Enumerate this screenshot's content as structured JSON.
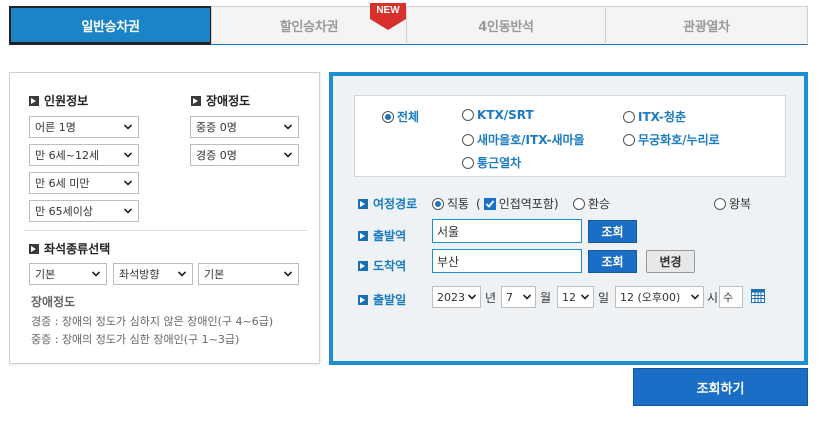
{
  "tabs": [
    {
      "label": "일반승차권",
      "active": true
    },
    {
      "label": "할인승차권",
      "badge": "NEW"
    },
    {
      "label": "4인동반석"
    },
    {
      "label": "관광열차"
    }
  ],
  "passengers": {
    "title": "인원정보",
    "selects": [
      "어른 1명",
      "만 6세~12세",
      "만 6세 미만",
      "만 65세이상"
    ]
  },
  "disability": {
    "title": "장애정도",
    "selects": [
      "중증 0명",
      "경증 0명"
    ]
  },
  "seat": {
    "title": "좌석종류선택",
    "selects": [
      "기본",
      "좌석방향",
      "기본"
    ]
  },
  "disability_info": {
    "title": "장애정도",
    "lines": [
      "경증 : 장애의 정도가 심하지 않은 장애인(구 4~6급)",
      "중증 : 장애의 정도가 심한 장애인(구 1~3급)"
    ]
  },
  "train_types": [
    {
      "label": "전체",
      "selected": true
    },
    {
      "label": "KTX/SRT",
      "selected": false
    },
    {
      "label": "ITX-청춘",
      "selected": false
    },
    {
      "label": "새마을호/ITX-새마을",
      "selected": false
    },
    {
      "label": "무궁화호/누리로",
      "selected": false
    },
    {
      "label": "통근열차",
      "selected": false
    }
  ],
  "route": {
    "label": "여정경로",
    "direct": "직통",
    "paren_open": "(",
    "adjacent": "인접역포함)",
    "transfer": "환승",
    "round_trip": "왕복"
  },
  "departure": {
    "label": "출발역",
    "value": "서울",
    "button": "조회"
  },
  "arrival": {
    "label": "도착역",
    "value": "부산",
    "button": "조회",
    "swap_button": "변경"
  },
  "date": {
    "label": "출발일",
    "year": "2023",
    "year_unit": "년",
    "month": "7",
    "month_unit": "월",
    "day": "12",
    "day_unit": "일",
    "hour": "12 (오후00)",
    "hour_unit": "시",
    "weekday": "수"
  },
  "search_button": "조회하기",
  "colors": {
    "accent": "#1c8fd1",
    "button": "#1b6ec6",
    "badge": "#d8302c"
  }
}
